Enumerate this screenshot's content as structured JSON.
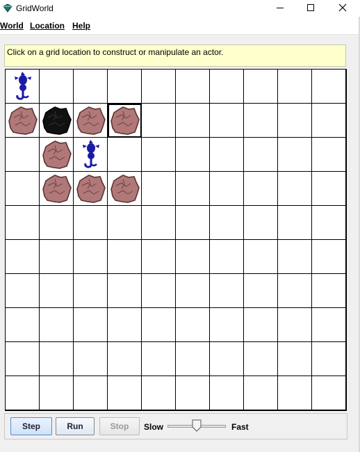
{
  "window": {
    "title": "GridWorld",
    "controls": [
      "minimize-icon",
      "maximize-icon",
      "close-icon"
    ]
  },
  "menu": {
    "world": "World",
    "location": "Location",
    "help": "Help"
  },
  "message": "Click on a grid location to construct or manipulate an actor.",
  "grid": {
    "rows": 10,
    "cols": 10,
    "selected": [
      1,
      3
    ],
    "actors": [
      {
        "row": 0,
        "col": 0,
        "type": "flower-bug-icon",
        "color": "#1a1aa8"
      },
      {
        "row": 1,
        "col": 0,
        "type": "rock-icon",
        "color": "#b07878"
      },
      {
        "row": 1,
        "col": 1,
        "type": "rock-icon",
        "color": "#111111"
      },
      {
        "row": 1,
        "col": 2,
        "type": "rock-icon",
        "color": "#b07878"
      },
      {
        "row": 1,
        "col": 3,
        "type": "rock-icon",
        "color": "#b07878"
      },
      {
        "row": 2,
        "col": 1,
        "type": "rock-icon",
        "color": "#b07878"
      },
      {
        "row": 2,
        "col": 2,
        "type": "flower-bug-icon",
        "color": "#1a1aa8"
      },
      {
        "row": 3,
        "col": 1,
        "type": "rock-icon",
        "color": "#b07878"
      },
      {
        "row": 3,
        "col": 2,
        "type": "rock-icon",
        "color": "#b07878"
      },
      {
        "row": 3,
        "col": 3,
        "type": "rock-icon",
        "color": "#b07878"
      }
    ]
  },
  "controls": {
    "step": "Step",
    "run": "Run",
    "stop": "Stop",
    "slow": "Slow",
    "fast": "Fast",
    "speed_fraction": 0.5
  }
}
